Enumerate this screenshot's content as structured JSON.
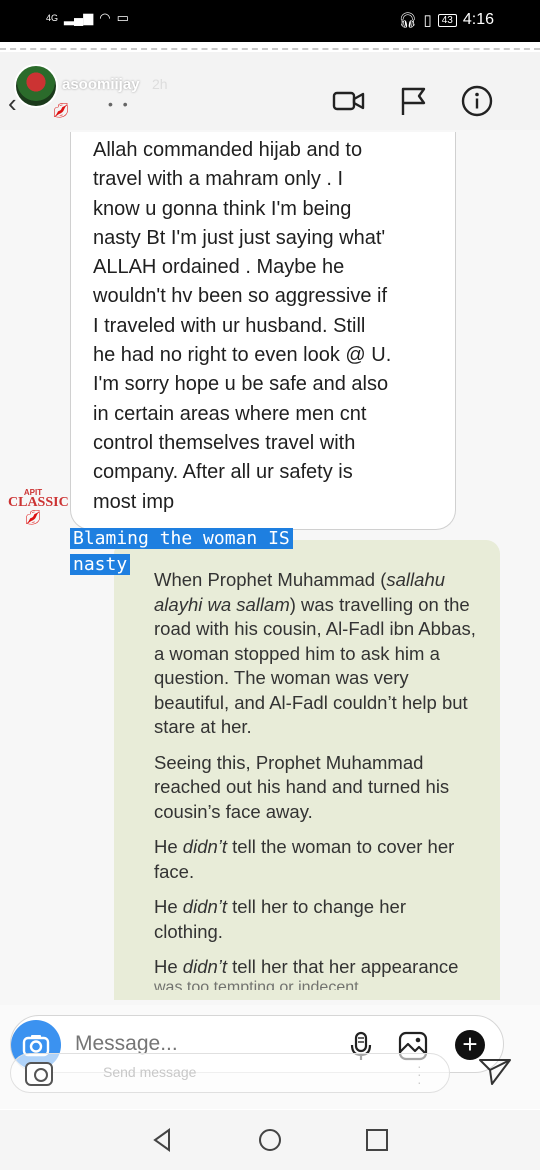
{
  "status_bar": {
    "network": "4G",
    "battery": "43",
    "time": "4:16"
  },
  "header": {
    "username": "asoomiijay",
    "time_ago": "2h",
    "icons": [
      "video-camera-icon",
      "flag-icon",
      "info-icon"
    ]
  },
  "message": {
    "lines": [
      "Allah commanded hijab and to",
      "travel with a mahram only . I",
      "know u gonna think I'm  being",
      "nasty Bt I'm just just saying what'",
      "ALLAH ordained . Maybe he",
      "wouldn't hv been so aggressive if",
      "I traveled with ur husband. Still",
      "he had no right to even look @ U.",
      "I'm sorry hope u be safe and also",
      "in certain areas where men cnt",
      "control themselves travel with",
      "company. After all ur safety is",
      "most imp"
    ]
  },
  "sender": {
    "label_top": "APIT",
    "label_main": "CLASSIC"
  },
  "caption": {
    "line1": "Blaming the woman IS",
    "line2": "nasty"
  },
  "shared_post": {
    "p1_a": "When Prophet Muhammad (",
    "p1_em": "sallahu alayhi wa sallam",
    "p1_b": ") was travelling on the road with his cousin, Al-Fadl ibn Abbas, a woman stopped him to ask him a question. The woman was very beautiful, and Al-Fadl couldn’t help but stare at her.",
    "p2": "Seeing this, Prophet Muhammad reached out his hand and turned his cousin’s face away.",
    "p3_a": "He ",
    "p3_em": "didn’t",
    "p3_b": " tell the woman to cover her face.",
    "p4_a": "He ",
    "p4_em": "didn’t",
    "p4_b": " tell her to change her clothing.",
    "p5_a": "He ",
    "p5_em": "didn’t",
    "p5_b": " tell her that her appearance",
    "p6": "was too tempting or indecent"
  },
  "composer": {
    "placeholder": "Message...",
    "send_placeholder": "Send message"
  },
  "nav": {
    "buttons": [
      "back",
      "home",
      "recents"
    ]
  }
}
